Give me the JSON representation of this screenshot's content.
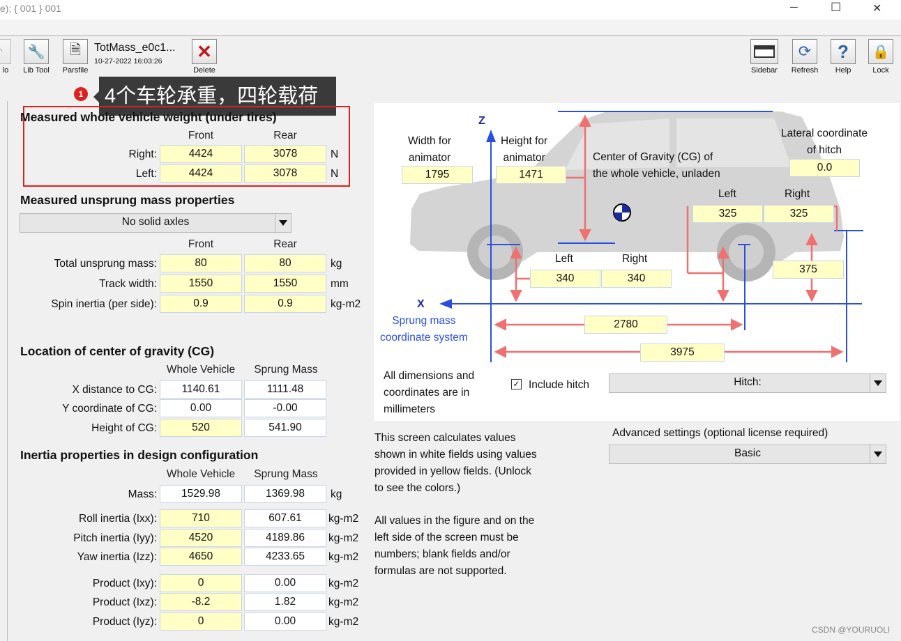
{
  "window": {
    "title": "e); { 001 } 001",
    "controls": {
      "minimize": "─",
      "maximize": "☐",
      "close": "✕"
    }
  },
  "toolbar": {
    "partial_left_label": "lo",
    "libtool_label": "Lib Tool",
    "parsfile_label": "Parsfile",
    "dataset_title": "TotMass_e0c1...",
    "dataset_date": "10-27-2022 16:03:26",
    "delete_label": "Delete",
    "sidebar_label": "Sidebar",
    "refresh_label": "Refresh",
    "help_label": "Help",
    "lock_label": "Lock"
  },
  "annotation": {
    "badge": "1",
    "text": "4个车轮承重，四轮载荷"
  },
  "weight": {
    "title": "Measured whole vehicle weight (under tires)",
    "col_front": "Front",
    "col_rear": "Rear",
    "right_label": "Right:",
    "left_label": "Left:",
    "right_front": "4424",
    "right_rear": "3078",
    "left_front": "4424",
    "left_rear": "3078",
    "unit": "N"
  },
  "unsprung": {
    "title": "Measured unsprung mass properties",
    "axle_option": "No solid axles",
    "col_front": "Front",
    "col_rear": "Rear",
    "rows": [
      {
        "label": "Total unsprung mass:",
        "front": "80",
        "rear": "80",
        "unit": "kg"
      },
      {
        "label": "Track width:",
        "front": "1550",
        "rear": "1550",
        "unit": "mm"
      },
      {
        "label": "Spin inertia (per side):",
        "front": "0.9",
        "rear": "0.9",
        "unit": "kg-m2"
      }
    ]
  },
  "cg": {
    "title": "Location of center of gravity (CG)",
    "col_whole": "Whole Vehicle",
    "col_sprung": "Sprung Mass",
    "rows": [
      {
        "label": "X distance  to CG:",
        "whole": "1140.61",
        "sprung": "1111.48"
      },
      {
        "label": "Y coordinate of CG:",
        "whole": "0.00",
        "sprung": "-0.00"
      },
      {
        "label": "Height of CG:",
        "whole": "520",
        "sprung": "541.90"
      }
    ]
  },
  "inertia": {
    "title": "Inertia properties in design configuration",
    "col_whole": "Whole Vehicle",
    "col_sprung": "Sprung Mass",
    "mass": {
      "label": "Mass:",
      "whole": "1529.98",
      "sprung": "1369.98",
      "unit": "kg"
    },
    "moments": [
      {
        "label": "Roll inertia (Ixx):",
        "whole": "710",
        "sprung": "607.61",
        "unit": "kg-m2"
      },
      {
        "label": "Pitch inertia (Iyy):",
        "whole": "4520",
        "sprung": "4189.86",
        "unit": "kg-m2"
      },
      {
        "label": "Yaw inertia (Izz):",
        "whole": "4650",
        "sprung": "4233.65",
        "unit": "kg-m2"
      }
    ],
    "products": [
      {
        "label": "Product (Ixy):",
        "whole": "0",
        "sprung": "0.00",
        "unit": "kg-m2"
      },
      {
        "label": "Product (Ixz):",
        "whole": "-8.2",
        "sprung": "1.82",
        "unit": "kg-m2"
      },
      {
        "label": "Product (Iyz):",
        "whole": "0",
        "sprung": "0.00",
        "unit": "kg-m2"
      }
    ]
  },
  "figure": {
    "width_label_1": "Width for",
    "width_label_2": "animator",
    "width_value": "1795",
    "height_label_1": "Height for",
    "height_label_2": "animator",
    "height_value": "1471",
    "cg_text_1": "Center of Gravity (CG) of",
    "cg_text_2": "the whole vehicle, unladen",
    "lateral_label_1": "Lateral coordinate",
    "lateral_label_2": "of hitch",
    "lateral_value": "0.0",
    "rear_left_label": "Left",
    "rear_right_label": "Right",
    "rear_left_value": "325",
    "rear_right_value": "325",
    "front_left_label": "Left",
    "front_right_label": "Right",
    "front_left_value": "340",
    "front_right_value": "340",
    "hitch_height": "375",
    "wheelbase": "2780",
    "overall_length": "3975",
    "z_axis": "Z",
    "x_axis": "X",
    "coord_label_1": "Sprung mass",
    "coord_label_2": "coordinate system",
    "dims_note_1": "All dimensions and",
    "dims_note_2": "coordinates are in",
    "dims_note_3": "millimeters",
    "include_hitch_label": "Include hitch",
    "hitch_option": "Hitch:"
  },
  "info": {
    "p1": [
      "This screen calculates values",
      "shown in white fields using values",
      "provided in yellow fields. (Unlock",
      "to see the colors.)"
    ],
    "p2": [
      "All values in the figure and on the",
      "left side of the screen must be",
      "numbers; blank fields and/or",
      "formulas are not supported."
    ]
  },
  "advanced": {
    "label": "Advanced settings (optional license required)",
    "option": "Basic"
  },
  "watermark": "CSDN @YOURUOLI",
  "colors": {
    "yellow_field": "#ffffc6",
    "dim_red": "#f07070",
    "axis_blue": "#2a4fe0",
    "annotation_red": "#e02020"
  }
}
